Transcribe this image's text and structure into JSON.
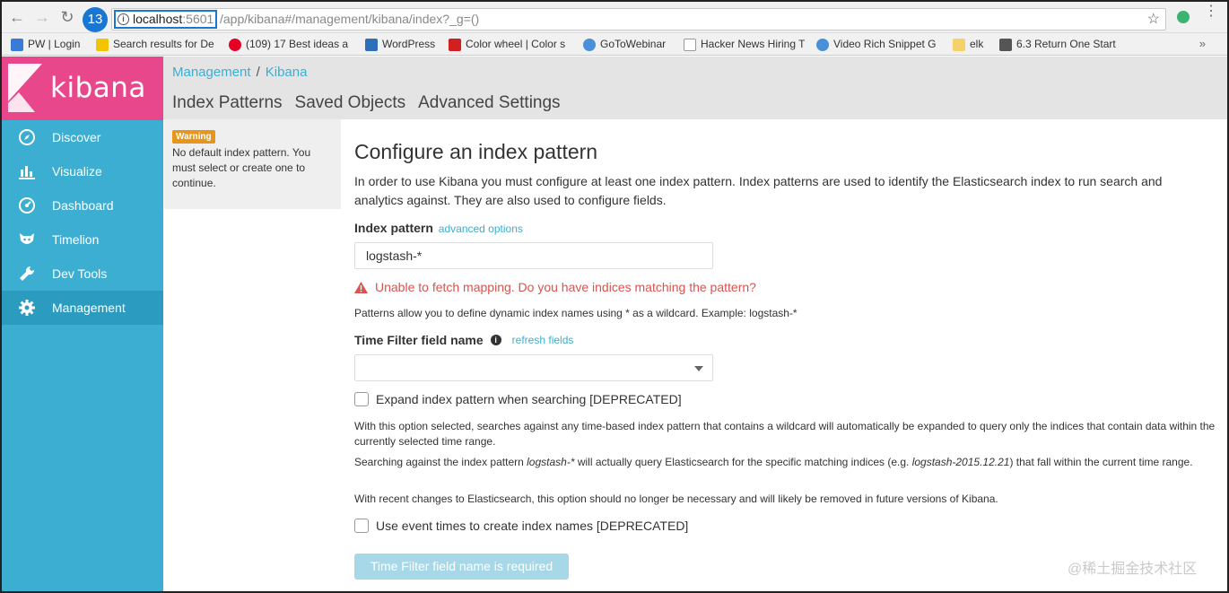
{
  "browser": {
    "step_badge": "13",
    "url_host": "localhost",
    "url_port": ":5601",
    "url_path": "/app/kibana#/management/kibana/index?_g=()",
    "bookmarks": [
      {
        "label": "PW | Login",
        "color": "#3a7bd5"
      },
      {
        "label": "Search results for De",
        "color": "#f2c500"
      },
      {
        "label": "(109) 17 Best ideas a",
        "color": "#e60023"
      },
      {
        "label": "WordPress",
        "color": "#2e6fb7"
      },
      {
        "label": "Color wheel | Color s",
        "color": "#d21f1f"
      },
      {
        "label": "GoToWebinar",
        "color": "#4a90d9"
      },
      {
        "label": "Hacker News Hiring T",
        "color": "#999999"
      },
      {
        "label": "Video Rich Snippet G",
        "color": "#4a90d9"
      },
      {
        "label": "elk",
        "color": "#f3d26a"
      },
      {
        "label": "6.3 Return One Start",
        "color": "#555555"
      }
    ],
    "more": "»"
  },
  "sidebar": {
    "logo_text": "kibana",
    "items": [
      {
        "label": "Discover",
        "icon": "compass-icon"
      },
      {
        "label": "Visualize",
        "icon": "bar-chart-icon"
      },
      {
        "label": "Dashboard",
        "icon": "dashboard-icon"
      },
      {
        "label": "Timelion",
        "icon": "timelion-icon"
      },
      {
        "label": "Dev Tools",
        "icon": "wrench-icon"
      },
      {
        "label": "Management",
        "icon": "gear-icon"
      }
    ]
  },
  "header": {
    "breadcrumb": [
      "Management",
      "Kibana"
    ],
    "breadcrumb_sep": "/",
    "tabs": [
      "Index Patterns",
      "Saved Objects",
      "Advanced Settings"
    ]
  },
  "warning": {
    "badge": "Warning",
    "text": "No default index pattern. You must select or create one to continue."
  },
  "main": {
    "title": "Configure an index pattern",
    "intro": "In order to use Kibana you must configure at least one index pattern. Index patterns are used to identify the Elasticsearch index to run search and analytics against. They are also used to configure fields.",
    "index_pattern_label": "Index pattern",
    "advanced_options": "advanced options",
    "index_pattern_value": "logstash-*",
    "error": "Unable to fetch mapping. Do you have indices matching the pattern?",
    "help": "Patterns allow you to define dynamic index names using * as a wildcard. Example: logstash-*",
    "time_filter_label": "Time Filter field name",
    "refresh_fields": "refresh fields",
    "expand_label": "Expand index pattern when searching [DEPRECATED]",
    "expand_note_1": "With this option selected, searches against any time-based index pattern that contains a wildcard will automatically be expanded to query only the indices that contain data within the currently selected time range.",
    "expand_note_2a": "Searching against the index pattern ",
    "expand_note_2b": "logstash-*",
    "expand_note_2c": " will actually query Elasticsearch for the specific matching indices (e.g. ",
    "expand_note_2d": "logstash-2015.12.21",
    "expand_note_2e": ") that fall within the current time range.",
    "expand_note_3": "With recent changes to Elasticsearch, this option should no longer be necessary and will likely be removed in future versions of Kibana.",
    "event_times_label": "Use event times to create index names [DEPRECATED]",
    "submit": "Time Filter field name is required"
  },
  "watermark": "@稀土掘金技术社区"
}
